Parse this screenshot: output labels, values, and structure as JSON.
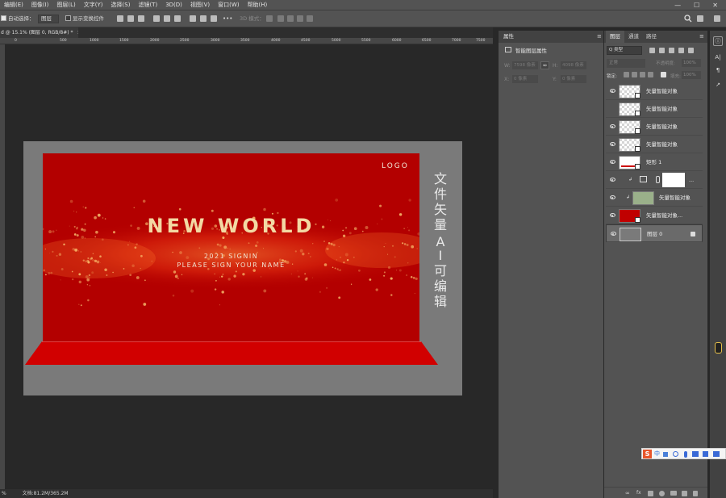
{
  "menu": [
    "编辑(E)",
    "图像(I)",
    "图层(L)",
    "文字(Y)",
    "选择(S)",
    "滤镜(T)",
    "3D(D)",
    "视图(V)",
    "窗口(W)",
    "帮助(H)"
  ],
  "window_controls": {
    "min": "—",
    "max": "☐",
    "close": "✕"
  },
  "options": {
    "auto_select_label": "自动选择：",
    "auto_select_target": "图层",
    "show_transform": "显示变换控件",
    "mode_3d": "3D 模式：",
    "more": "•••"
  },
  "doc_tab": {
    "title": "d @ 15.1% (图层 0, RGB/8#) *",
    "close": "×"
  },
  "ruler_ticks": [
    "0",
    "500",
    "1000",
    "1500",
    "2000",
    "2500",
    "3000",
    "3500",
    "4000",
    "4500",
    "5000",
    "5500",
    "6000",
    "6500",
    "7000",
    "7500",
    "8000"
  ],
  "status": {
    "zoom": "%",
    "docsize": "文档:81.2M/365.2M"
  },
  "design": {
    "logo": "LOGO",
    "headline": "NEW WORLD",
    "sub1": "2021 SIGNIN",
    "sub2": "PLEASE SIGN YOUR NAME",
    "vert": [
      "文",
      "件",
      "矢",
      "量",
      "A",
      "I",
      "可",
      "编",
      "辑"
    ]
  },
  "properties": {
    "title": "属性",
    "heading": "智能图层属性",
    "w_label": "W:",
    "w_val": "7598 像素",
    "link": "∞",
    "h_label": "H:",
    "h_val": "4098 像素",
    "x_label": "X:",
    "x_val": "0 像素",
    "y_label": "Y:",
    "y_val": "0 像素"
  },
  "layers": {
    "tabs": [
      "图层",
      "通道",
      "路径"
    ],
    "kind": "Q 类型",
    "blend": "正常",
    "opacity_label": "不透明度:",
    "opacity": "100%",
    "lock_label": "锁定:",
    "fill_label": "填充:",
    "fill": "100%",
    "items": [
      {
        "name": "矢量智能对象",
        "eye": true,
        "thumb": "checker"
      },
      {
        "name": "矢量智能对象",
        "eye": false,
        "thumb": "checker"
      },
      {
        "name": "矢量智能对象",
        "eye": true,
        "thumb": "checker"
      },
      {
        "name": "矢量智能对象",
        "eye": true,
        "thumb": "checker"
      },
      {
        "name": "矩形 1",
        "eye": true,
        "thumb": "rect"
      },
      {
        "name": "...",
        "eye": true,
        "thumb": "adjust"
      },
      {
        "name": "矢量智能对象",
        "eye": true,
        "thumb": "shape"
      },
      {
        "name": "矢量智能对象...",
        "eye": true,
        "thumb": "red"
      },
      {
        "name": "图层 0",
        "eye": true,
        "thumb": "gray",
        "locked": true
      }
    ]
  },
  "right_tools": [
    "ⓘ",
    "A|",
    "¶",
    "↗"
  ],
  "ime": {
    "brand": "S",
    "text": "中"
  },
  "colors": {
    "chrome": "#535353",
    "doc_gray": "#7a7a7a",
    "red": "#b30000",
    "gold": "#f3d9a3"
  }
}
